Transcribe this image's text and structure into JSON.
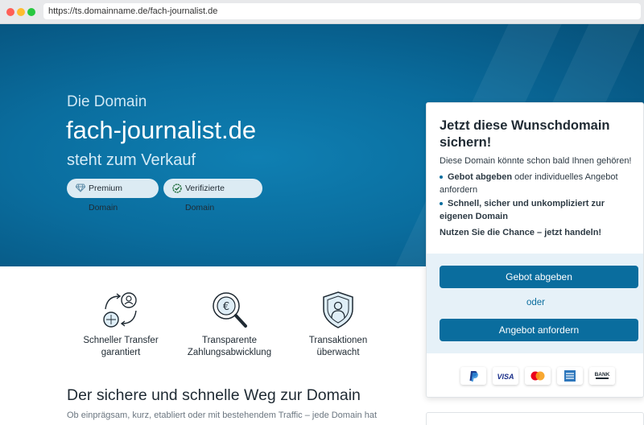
{
  "browser": {
    "url": "https://ts.domainname.de/fach-journalist.de"
  },
  "hero": {
    "pre_title": "Die Domain",
    "domain": "fach-journalist.de",
    "subtitle": "steht zum Verkauf",
    "badges": [
      {
        "label": "Premium Domain",
        "icon": "diamond-icon"
      },
      {
        "label": "Verifizierte Domain",
        "icon": "verified-check-icon"
      }
    ]
  },
  "features": [
    {
      "label": "Schneller Transfer garantiert",
      "icon": "transfer-icon"
    },
    {
      "label": "Transparente Zahlungsabwicklung",
      "icon": "euro-magnifier-icon"
    },
    {
      "label": "Transaktionen überwacht",
      "icon": "shield-user-icon"
    }
  ],
  "section": {
    "title": "Der sichere und schnelle Weg zur Domain",
    "text": "Ob einprägsam, kurz, etabliert oder mit bestehendem Traffic – jede Domain hat"
  },
  "card": {
    "title": "Jetzt diese Wunschdomain sichern!",
    "subtitle": "Diese Domain könnte schon bald Ihnen gehören!",
    "bullet1_bold": "Gebot abgeben",
    "bullet1_rest": " oder individuelles Angebot anfordern",
    "bullet2_bold": "Schnell, sicher und unkompliziert zur eigenen Domain",
    "cta": "Nutzen Sie die Chance – jetzt handeln!",
    "bid_button": "Gebot abgeben",
    "or": "oder",
    "offer_button": "Angebot anfordern",
    "payments": [
      "paypal-icon",
      "visa-icon",
      "mastercard-icon",
      "amex-icon",
      "bank-transfer-icon"
    ],
    "visa_text": "VISA",
    "bank_text": "BANK"
  },
  "colors": {
    "primary": "#0a6d9e",
    "hero_bg": "#075985",
    "actions_bg": "#e6f1f8"
  }
}
